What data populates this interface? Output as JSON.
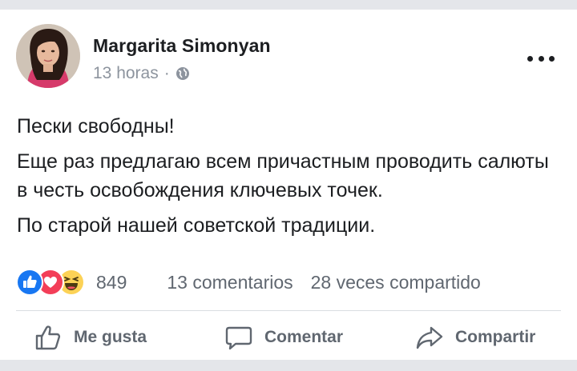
{
  "post": {
    "author": "Margarita Simonyan",
    "time": "13 horas",
    "separator": "·",
    "privacy_icon": "globe-icon",
    "more_icon": "more-dots-icon",
    "paragraphs": [
      "Пески свободны!",
      "Еще раз предлагаю всем причастным проводить салюты в честь освобождения ключевых точек.",
      "По старой нашей советской традиции."
    ]
  },
  "stats": {
    "reaction_icons": [
      "like-reaction-icon",
      "love-reaction-icon",
      "haha-reaction-icon"
    ],
    "reaction_count": "849",
    "comments": "13 comentarios",
    "shares": "28 veces compartido"
  },
  "actions": {
    "like": "Me gusta",
    "comment": "Comentar",
    "share": "Compartir"
  },
  "colors": {
    "like_blue": "#1877f2",
    "love_red": "#f33e58",
    "haha_yellow": "#fcd256",
    "text_primary": "#1c1e21",
    "text_secondary": "#606770",
    "meta_gray": "#8d949e"
  }
}
